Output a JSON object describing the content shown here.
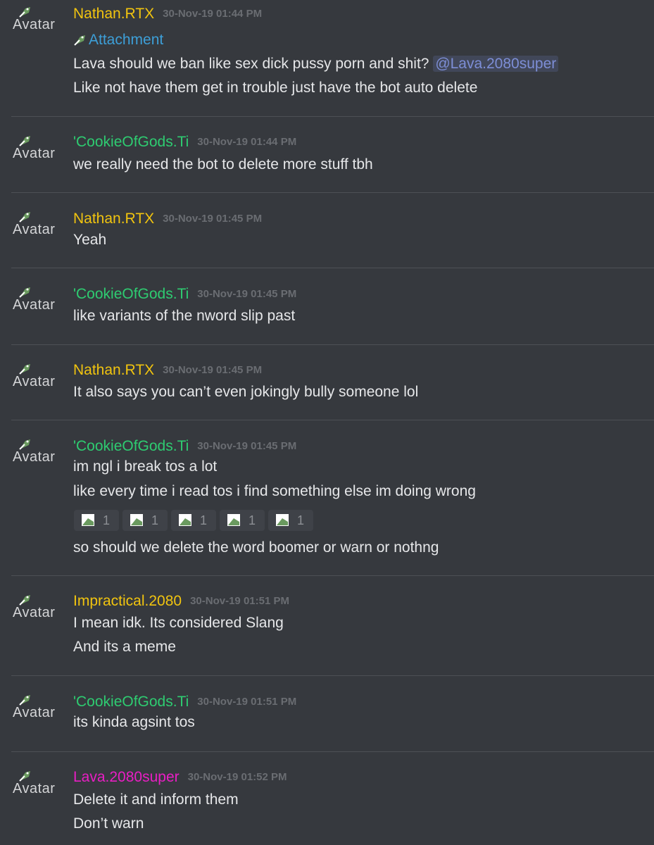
{
  "avatar_alt": "Avatar",
  "attachment_alt": "Attachment",
  "colors": {
    "background": "#36393e",
    "divider": "#4d5055",
    "text": "#e6e7e9",
    "timestamp": "#6a6d72",
    "mention": "#7d8ed6",
    "link": "#3d9fd8",
    "nathan": "#f1c40f",
    "cookie": "#2ecc71",
    "impractical": "#f1c40f",
    "lava": "#e91ec4"
  },
  "messages": [
    {
      "author": "Nathan.RTX",
      "timestamp": "30-Nov-19 01:44 PM",
      "line1_pre": "Lava should we ban like sex dick pussy porn and shit?",
      "mention": "@Lava.2080super",
      "line2": "Like not have them get in trouble just have the bot auto delete"
    },
    {
      "author": "'CookieOfGods.Ti",
      "timestamp": "30-Nov-19 01:44 PM",
      "lines": [
        "we really need the bot to delete more stuff tbh"
      ]
    },
    {
      "author": "Nathan.RTX",
      "timestamp": "30-Nov-19 01:45 PM",
      "lines": [
        "Yeah"
      ]
    },
    {
      "author": "'CookieOfGods.Ti",
      "timestamp": "30-Nov-19 01:45 PM",
      "lines": [
        "like variants of the nword slip past"
      ]
    },
    {
      "author": "Nathan.RTX",
      "timestamp": "30-Nov-19 01:45 PM",
      "lines": [
        "It also says you can’t even jokingly bully someone lol"
      ]
    },
    {
      "author": "'CookieOfGods.Ti",
      "timestamp": "30-Nov-19 01:45 PM",
      "lines": [
        "im ngl i break tos a lot",
        "like every time i read tos i find something else im doing wrong",
        "so should we delete the word boomer or warn or nothng"
      ],
      "reactions": [
        "1",
        "1",
        "1",
        "1",
        "1"
      ]
    },
    {
      "author": "Impractical.2080",
      "timestamp": "30-Nov-19 01:51 PM",
      "lines": [
        "I mean idk. Its considered Slang",
        "And its a meme"
      ]
    },
    {
      "author": "'CookieOfGods.Ti",
      "timestamp": "30-Nov-19 01:51 PM",
      "lines": [
        "its kinda agsint tos"
      ]
    },
    {
      "author": "Lava.2080super",
      "timestamp": "30-Nov-19 01:52 PM",
      "lines": [
        "Delete it and inform them",
        "Don’t warn"
      ]
    }
  ]
}
